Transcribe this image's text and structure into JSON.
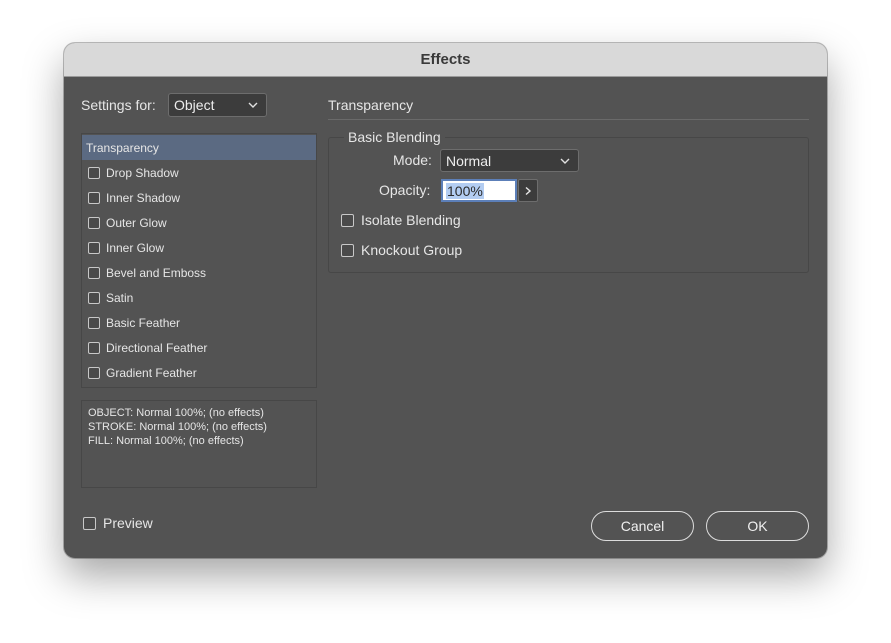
{
  "dialog": {
    "title": "Effects"
  },
  "settings": {
    "label": "Settings for:",
    "selected": "Object"
  },
  "effects_list": {
    "items": [
      {
        "label": "Transparency",
        "checkbox": false,
        "selected": true
      },
      {
        "label": "Drop Shadow",
        "checkbox": true,
        "checked": false
      },
      {
        "label": "Inner Shadow",
        "checkbox": true,
        "checked": false
      },
      {
        "label": "Outer Glow",
        "checkbox": true,
        "checked": false
      },
      {
        "label": "Inner Glow",
        "checkbox": true,
        "checked": false
      },
      {
        "label": "Bevel and Emboss",
        "checkbox": true,
        "checked": false
      },
      {
        "label": "Satin",
        "checkbox": true,
        "checked": false
      },
      {
        "label": "Basic Feather",
        "checkbox": true,
        "checked": false
      },
      {
        "label": "Directional Feather",
        "checkbox": true,
        "checked": false
      },
      {
        "label": "Gradient Feather",
        "checkbox": true,
        "checked": false
      }
    ]
  },
  "summary": {
    "lines": [
      "OBJECT: Normal 100%; (no effects)",
      "STROKE: Normal 100%; (no effects)",
      "FILL: Normal 100%; (no effects)"
    ]
  },
  "panel": {
    "title": "Transparency",
    "group_title": "Basic Blending",
    "mode_label": "Mode:",
    "mode_value": "Normal",
    "opacity_label": "Opacity:",
    "opacity_value": "100%",
    "isolate_label": "Isolate Blending",
    "knockout_label": "Knockout Group"
  },
  "footer": {
    "preview_label": "Preview",
    "cancel_label": "Cancel",
    "ok_label": "OK"
  },
  "colors": {
    "dialog_bg": "#535353",
    "titlebar_bg": "#d9d9d9",
    "selection_bg": "#5b6a82",
    "focus_ring": "#5c7fb8"
  },
  "icons": [
    "chevron-down-icon",
    "chevron-right-icon",
    "checkbox-icon"
  ]
}
